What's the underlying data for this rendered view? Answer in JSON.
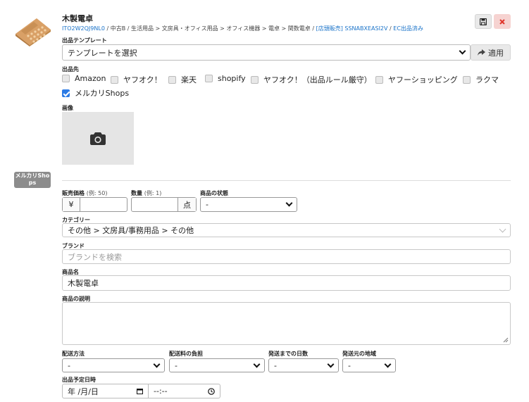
{
  "product": {
    "title": "木製電卓",
    "sku": "ITO2W2QJ9NL0",
    "breadcrumb_path": " / 中古B / 生活用品 > 文房具・オフィス用品 > オフィス機器 > 電卓 > 関数電卓 / ",
    "shop_link": "[店頭販売] SSNABXEASI2V",
    "separator": " / ",
    "status_link": "EC出品済み"
  },
  "template": {
    "label": "出品テンプレート",
    "selected": "テンプレートを選択",
    "apply_label": "適用"
  },
  "destinations": {
    "label": "出品先",
    "options": [
      {
        "label": "Amazon",
        "checked": false
      },
      {
        "label": "ヤフオク！",
        "checked": false
      },
      {
        "label": "楽天",
        "checked": false
      },
      {
        "label": "shopify",
        "checked": false
      },
      {
        "label": "ヤフオク！（出品ルール厳守）",
        "checked": false
      },
      {
        "label": "ヤフーショッピング",
        "checked": false
      },
      {
        "label": "ラクマ",
        "checked": false
      },
      {
        "label": "メルカリShops",
        "checked": true
      }
    ]
  },
  "image": {
    "label": "画像"
  },
  "badge": {
    "label": "メルカリShops"
  },
  "price": {
    "label": "販売価格",
    "hint": "(例: 50)",
    "prefix": "¥",
    "value": ""
  },
  "quantity": {
    "label": "数量",
    "hint": "(例: 1)",
    "suffix": "点",
    "value": ""
  },
  "condition": {
    "label": "商品の状態",
    "selected": "-"
  },
  "category": {
    "label": "カテゴリー",
    "value": "その他 > 文房具/事務用品 > その他"
  },
  "brand": {
    "label": "ブランド",
    "placeholder": "ブランドを検索"
  },
  "name": {
    "label": "商品名",
    "value": "木製電卓"
  },
  "description": {
    "label": "商品の説明",
    "value": ""
  },
  "shipping": {
    "method": {
      "label": "配送方法",
      "selected": "-"
    },
    "fee_burden": {
      "label": "配送料の負担",
      "selected": "-"
    },
    "days": {
      "label": "発送までの日数",
      "selected": "-"
    },
    "origin": {
      "label": "発送元の地域",
      "selected": "-"
    }
  },
  "schedule": {
    "label": "出品予定日時",
    "date_placeholder": "年 /月/日",
    "time_placeholder": "--:--"
  },
  "icons": {
    "save": "floppy-disk-icon",
    "close": "close-icon",
    "camera": "camera-icon",
    "share": "share-arrow-icon",
    "calendar": "calendar-icon",
    "clock": "clock-icon"
  },
  "colors": {
    "accent": "#2c7be5",
    "danger": "#e0352b",
    "link": "#1a73c9",
    "badge": "#8c8c8c"
  }
}
